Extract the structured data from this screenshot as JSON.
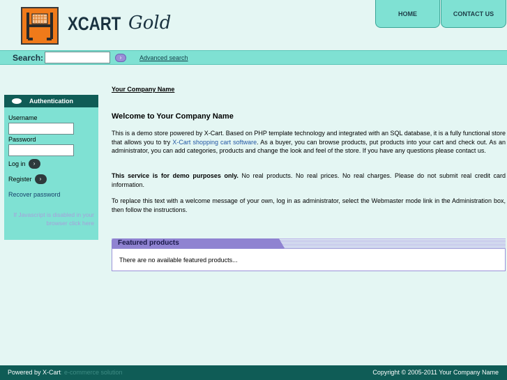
{
  "header": {
    "logo_main": "XCART",
    "logo_accent": "Gold",
    "nav": [
      {
        "label": "HOME"
      },
      {
        "label": "CONTACT US"
      }
    ]
  },
  "search": {
    "label": "Search:",
    "value": "",
    "go_label": "›",
    "advanced_label": "Advanced search"
  },
  "auth": {
    "title": "Authentication",
    "username_label": "Username",
    "password_label": "Password",
    "login_label": "Log in",
    "register_label": "Register",
    "recover_label": "Recover password",
    "js_note": "If Javascript is disabled in your browser click here"
  },
  "main": {
    "breadcrumb": "Your Company Name",
    "welcome_title": "Welcome to Your Company Name",
    "para1_before": "This is a demo store powered by X-Cart. Based on PHP template technology and integrated with an SQL database, it is a fully functional store that allows you to try ",
    "para1_link": "X-Cart shopping cart software",
    "para1_after": ". As a buyer, you can browse products, put products into your cart and check out. As an administrator, you can add categories, products and change the look and feel of the store. If you have any questions please contact us.",
    "para2_bold": "This service is for demo purposes only.",
    "para2_rest": " No real products. No real prices. No real charges. Please do not submit real credit card information.",
    "para3": "To replace this text with a welcome message of your own, log in as administrator, select the Webmaster mode link in the Administration box, then follow the instructions.",
    "featured_title": "Featured products",
    "featured_empty": "There are no available featured products..."
  },
  "footer": {
    "powered_by": "Powered by X-Cart",
    "powered_suffix": ": e-commerce solution",
    "copyright": "Copyright © 2005-2011 Your Company Name"
  },
  "colors": {
    "background": "#e4f6f3",
    "accent": "#7fe1d3",
    "dark": "#0f5c56",
    "featured": "#8f83d1"
  }
}
